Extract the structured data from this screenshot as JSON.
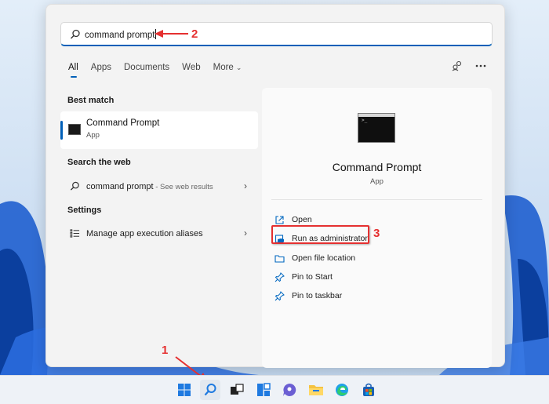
{
  "search": {
    "value": "command prompt"
  },
  "filters": [
    {
      "label": "All",
      "active": true
    },
    {
      "label": "Apps"
    },
    {
      "label": "Documents"
    },
    {
      "label": "Web"
    },
    {
      "label": "More"
    }
  ],
  "left": {
    "best_match_title": "Best match",
    "best_match": {
      "name": "Command Prompt",
      "kind": "App"
    },
    "web_title": "Search the web",
    "web_item": {
      "query": "command prompt",
      "suffix": " - See web results"
    },
    "settings_title": "Settings",
    "settings_item": {
      "label": "Manage app execution aliases"
    }
  },
  "detail": {
    "name": "Command Prompt",
    "kind": "App",
    "actions": [
      {
        "label": "Open",
        "icon": "open-icon"
      },
      {
        "label": "Run as administrator",
        "icon": "shield-icon"
      },
      {
        "label": "Open file location",
        "icon": "folder-icon"
      },
      {
        "label": "Pin to Start",
        "icon": "pin-icon"
      },
      {
        "label": "Pin to taskbar",
        "icon": "pin-icon"
      }
    ]
  },
  "annotations": {
    "n1": "1",
    "n2": "2",
    "n3": "3"
  },
  "taskbar": {
    "icons": [
      "start-icon",
      "search-icon",
      "task-view-icon",
      "widgets-icon",
      "teams-chat-icon",
      "file-explorer-icon",
      "edge-icon",
      "store-icon"
    ]
  },
  "colors": {
    "accent": "#005fb8",
    "annotation": "#e53030"
  }
}
